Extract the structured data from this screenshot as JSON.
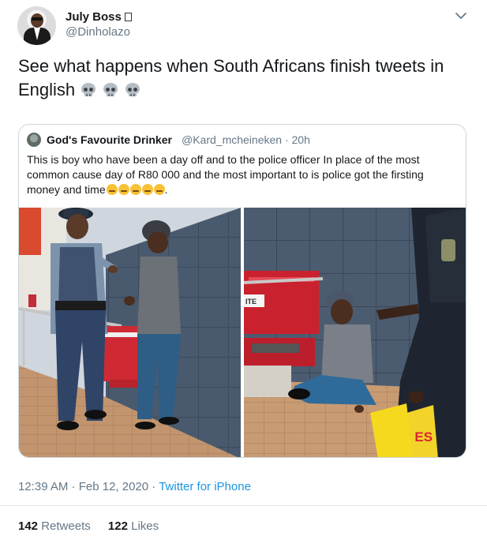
{
  "tweet": {
    "author_name": "July Boss",
    "author_handle": "@Dinholazo",
    "text": "See what happens when South Africans finish tweets in English",
    "timestamp": "12:39 AM · Feb 12, 2020",
    "source": "Twitter for iPhone",
    "retweets_count": "142",
    "retweets_label": "Retweets",
    "likes_count": "122",
    "likes_label": "Likes"
  },
  "quoted_tweet": {
    "author_name": "God's Favourite Drinker",
    "author_handle": "@Kard_mcheineken",
    "age": "20h",
    "text": "This is boy who have been a day off and to the police officer In place of the most common cause day of R80 000 and the most important to is police got the firsting money and time",
    "text_suffix": ".",
    "bag_text": "WER ES",
    "sign_text": "ITE"
  },
  "icons": [
    "skull-icon",
    "caret-down-icon",
    "grimacing-face-icon",
    "expressionless-face-icon",
    "relieved-face-icon",
    "hushed-face-icon",
    "persevering-face-icon"
  ]
}
